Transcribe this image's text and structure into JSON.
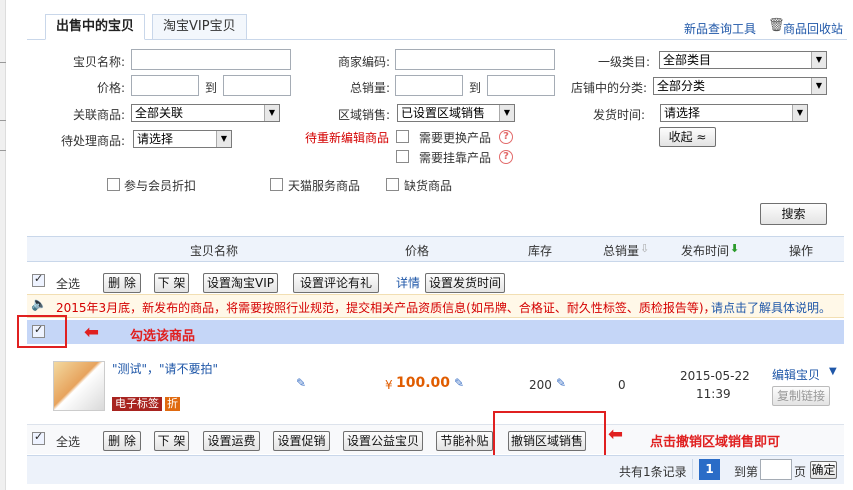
{
  "tabs": [
    "出售中的宝贝",
    "淘宝VIP宝贝"
  ],
  "top_links": [
    "新品查询工具",
    "商品回收站"
  ],
  "form": {
    "name_label": "宝贝名称:",
    "merchant_code_label": "商家编码:",
    "category_label": "一级类目:",
    "category_value": "全部类目",
    "price_label": "价格:",
    "to": "到",
    "sales_label": "总销量:",
    "shop_category_label": "店铺中的分类:",
    "shop_category_value": "全部分类",
    "related_label": "关联商品:",
    "related_value": "全部关联",
    "region_label": "区域销售:",
    "region_value": "已设置区域销售",
    "ship_time_label": "发货时间:",
    "ship_time_value": "请选择",
    "pending_label": "待处理商品:",
    "pending_value": "请选择",
    "pending_edit_label": "待重新编辑商品",
    "need_replace": "需要更换产品",
    "need_attach": "需要挂靠产品",
    "collapse_btn": "收起 ≈",
    "member_discount": "参与会员折扣",
    "tmall_service": "天猫服务商品",
    "out_of_stock": "缺货商品",
    "search_btn": "搜索"
  },
  "table_headers": {
    "name": "宝贝名称",
    "price": "价格",
    "stock": "库存",
    "total_sales": "总销量",
    "publish_time": "发布时间",
    "action": "操作"
  },
  "toolbar_top": {
    "select_all": "全选",
    "delete": "删 除",
    "delist": "下 架",
    "vip": "设置淘宝VIP",
    "comment": "设置评论有礼",
    "details": "详情",
    "ship_time": "设置发货时间"
  },
  "notice": {
    "text": "2015年3月底，新发布的商品，将需要按照行业规范，提交相关产品资质信息(如吊牌、合格证、耐久性标签、质检报告等)，",
    "link": "请点击了解具体说明。"
  },
  "annotations": {
    "check_item": "勾选该商品",
    "click_cancel": "点击撤销区域销售即可"
  },
  "item": {
    "title": "\"测试\"，\"请不要拍\"",
    "badge": "电子标签",
    "badge_zhe": "折",
    "price": "100.00",
    "currency": "¥",
    "stock": "200",
    "sales": "0",
    "date": "2015-05-22",
    "time": "11:39",
    "edit_link": "编辑宝贝",
    "copy_link": "复制链接"
  },
  "toolbar_bottom": {
    "select_all": "全选",
    "delete": "删 除",
    "delist": "下 架",
    "shipping": "设置运费",
    "promo": "设置促销",
    "charity": "设置公益宝贝",
    "energy": "节能补贴",
    "cancel_region": "撤销区域销售"
  },
  "pagination": {
    "total": "共有1条记录",
    "current_page": "1",
    "goto_prefix": "到第",
    "goto_suffix": "页",
    "confirm": "确定"
  },
  "colors": {
    "link_blue": "#1f57a8",
    "annotation_red": "#e02020",
    "price_orange": "#e05c00",
    "highlight_row": "#c5d6f7"
  }
}
